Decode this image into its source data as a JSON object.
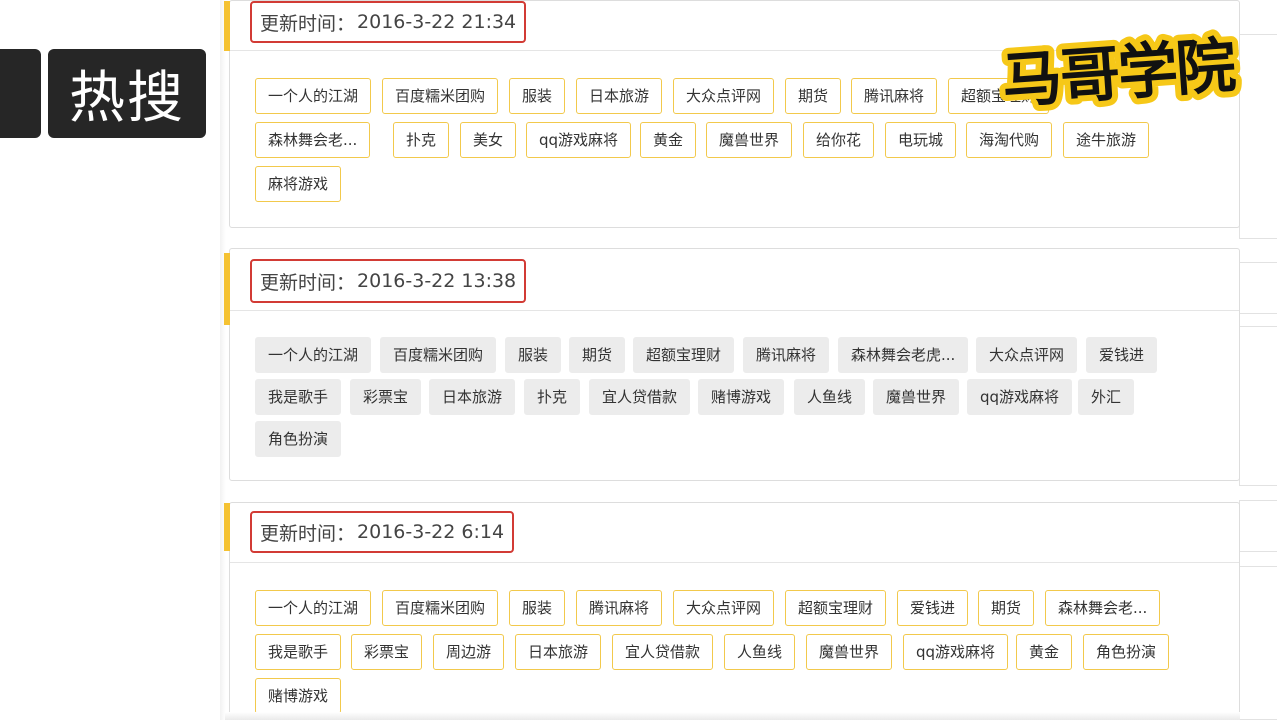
{
  "heading": "热搜",
  "logo_text": "马哥学院",
  "time_label": "更新时间：",
  "panels": [
    {
      "time": "2016-3-22 21:34",
      "tags": [
        "一个人的江湖",
        "百度糯米团购",
        "服装",
        "日本旅游",
        "大众点评网",
        "期货",
        "腾讯麻将",
        "超额宝理财",
        "森林舞会老...",
        "扑克",
        "美女",
        "qq游戏麻将",
        "黄金",
        "魔兽世界",
        "给你花",
        "电玩城",
        "海淘代购",
        "途牛旅游",
        "麻将游戏"
      ]
    },
    {
      "time": "2016-3-22 13:38",
      "tags": [
        "一个人的江湖",
        "百度糯米团购",
        "服装",
        "期货",
        "超额宝理财",
        "腾讯麻将",
        "森林舞会老虎...",
        "大众点评网",
        "爱钱进",
        "我是歌手",
        "彩票宝",
        "日本旅游",
        "扑克",
        "宜人贷借款",
        "赌博游戏",
        "人鱼线",
        "魔兽世界",
        "qq游戏麻将",
        "外汇",
        "角色扮演"
      ]
    },
    {
      "time": "2016-3-22 6:14",
      "tags": [
        "一个人的江湖",
        "百度糯米团购",
        "服装",
        "腾讯麻将",
        "大众点评网",
        "超额宝理财",
        "爱钱进",
        "期货",
        "森林舞会老...",
        "我是歌手",
        "彩票宝",
        "周边游",
        "日本旅游",
        "宜人贷借款",
        "人鱼线",
        "魔兽世界",
        "qq游戏麻将",
        "黄金",
        "角色扮演",
        "赌博游戏"
      ]
    }
  ]
}
